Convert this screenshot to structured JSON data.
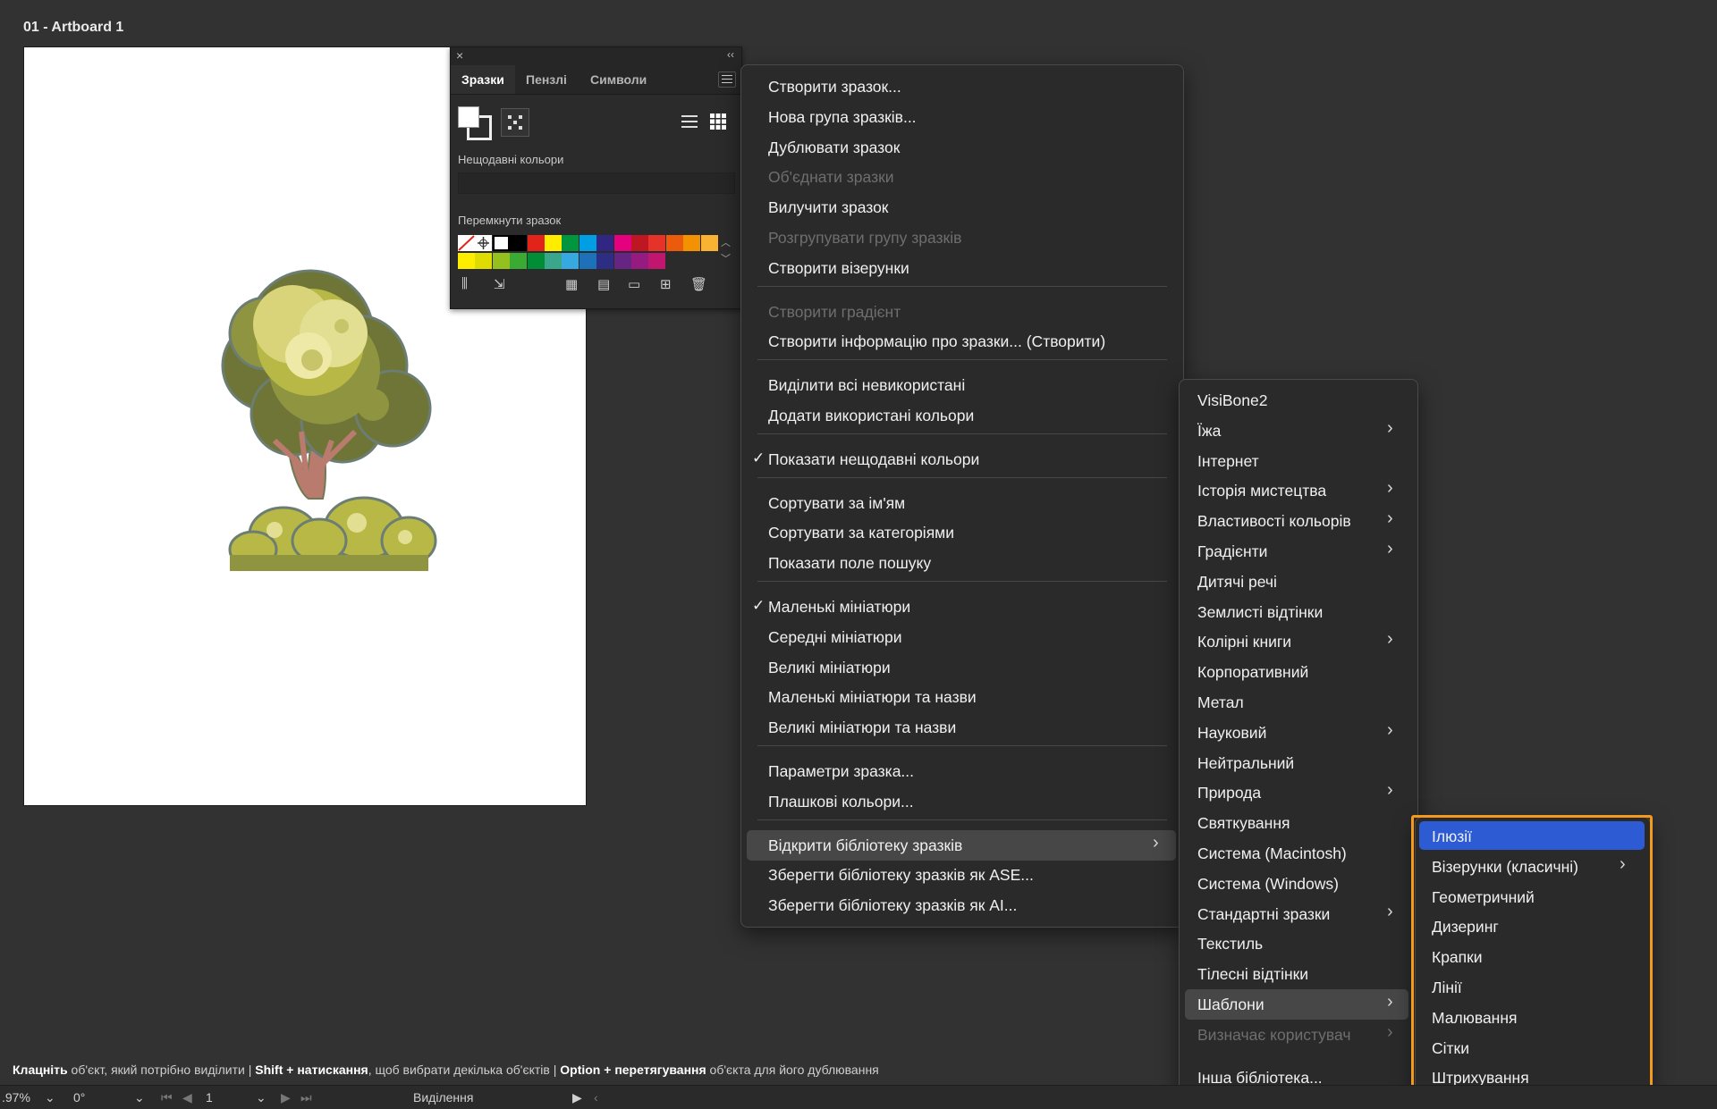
{
  "artboard": {
    "label": "01 - Artboard 1"
  },
  "panel": {
    "tabs": [
      "Зразки",
      "Пензлі",
      "Символи"
    ],
    "recent_colors_label": "Нещодавні кольори",
    "toggle_swatch_label": "Перемкнути зразок",
    "swatch_row1": [
      "#ffffff",
      "#ffffff",
      "#ffffff",
      "#000000",
      "#e2231a",
      "#ffed00",
      "#00963f",
      "#009ee3",
      "#312783",
      "#e5007d",
      "#be1622",
      "#e6332a",
      "#ea5b0c",
      "#f39200",
      "#f9b233"
    ],
    "swatch_row2": [
      "#ffed00",
      "#dedc00",
      "#95c11f",
      "#3aaa35",
      "#008d36",
      "#3aa78c",
      "#36a9e1",
      "#1d71b8",
      "#2d2e83",
      "#662483",
      "#951b81",
      "#c0166f"
    ]
  },
  "main_menu": {
    "items": [
      {
        "label": "Створити зразок...",
        "disabled": false
      },
      {
        "label": "Нова група зразків...",
        "disabled": false
      },
      {
        "label": "Дублювати зразок",
        "disabled": false
      },
      {
        "label": "Об'єднати зразки",
        "disabled": true
      },
      {
        "label": "Вилучити зразок",
        "disabled": false
      },
      {
        "label": "Розгрупувати групу зразків",
        "disabled": true
      },
      {
        "label": "Створити візерунки",
        "disabled": false
      },
      {
        "label": "Створити градієнт",
        "disabled": true
      },
      {
        "label": "Створити інформацію про зразки... (Створити)",
        "disabled": false
      },
      {
        "label": "Виділити всі невикористані",
        "disabled": false
      },
      {
        "label": "Додати використані кольори",
        "disabled": false
      },
      {
        "label": "Показати нещодавні кольори",
        "checked": true
      },
      {
        "label": "Сортувати за ім'ям",
        "disabled": false
      },
      {
        "label": "Сортувати за категоріями",
        "disabled": false
      },
      {
        "label": "Показати поле пошуку",
        "disabled": false
      },
      {
        "label": "Маленькі мініатюри",
        "checked": true
      },
      {
        "label": "Середні мініатюри",
        "disabled": false
      },
      {
        "label": "Великі мініатюри",
        "disabled": false
      },
      {
        "label": "Маленькі мініатюри та назви",
        "disabled": false
      },
      {
        "label": "Великі мініатюри та назви",
        "disabled": false
      },
      {
        "label": "Параметри зразка...",
        "disabled": false
      },
      {
        "label": "Плашкові кольори...",
        "disabled": false
      },
      {
        "label": "Відкрити бібліотеку зразків",
        "submenu": true,
        "highlighted": true
      },
      {
        "label": "Зберегти бібліотеку зразків як ASE...",
        "disabled": false
      },
      {
        "label": "Зберегти бібліотеку зразків як AI...",
        "disabled": false
      }
    ],
    "check_glyph": "✓",
    "arrow_glyph": "›"
  },
  "library_menu": {
    "items": [
      {
        "label": "VisiBone2"
      },
      {
        "label": "Їжа",
        "submenu": true
      },
      {
        "label": "Інтернет"
      },
      {
        "label": "Історія мистецтва",
        "submenu": true
      },
      {
        "label": "Властивості кольорів",
        "submenu": true
      },
      {
        "label": "Градієнти",
        "submenu": true
      },
      {
        "label": "Дитячі речі"
      },
      {
        "label": "Землисті відтінки"
      },
      {
        "label": "Колірні книги",
        "submenu": true
      },
      {
        "label": "Корпоративний"
      },
      {
        "label": "Метал"
      },
      {
        "label": "Науковий",
        "submenu": true
      },
      {
        "label": "Нейтральний"
      },
      {
        "label": "Природа",
        "submenu": true
      },
      {
        "label": "Святкування"
      },
      {
        "label": "Система (Macintosh)"
      },
      {
        "label": "Система (Windows)"
      },
      {
        "label": "Стандартні зразки",
        "submenu": true
      },
      {
        "label": "Текстиль"
      },
      {
        "label": "Тілесні відтінки"
      },
      {
        "label": "Шаблони",
        "submenu": true,
        "highlighted": true
      },
      {
        "label": "Визначає користувач",
        "submenu": true,
        "disabled": true
      },
      {
        "label": "Інша бібліотека..."
      }
    ]
  },
  "patterns_menu": {
    "items": [
      {
        "label": "Ілюзії",
        "selected": true
      },
      {
        "label": "Візерунки (класичні)",
        "submenu": true
      },
      {
        "label": "Геометричний"
      },
      {
        "label": "Дизеринг"
      },
      {
        "label": "Крапки"
      },
      {
        "label": "Лінії"
      },
      {
        "label": "Малювання"
      },
      {
        "label": "Сітки"
      },
      {
        "label": "Штрихування"
      }
    ]
  },
  "status": {
    "part1_bold": "Клацніть",
    "part1": " об'єкт, який потрібно виділити  |  ",
    "part2_bold": "Shift + натискання",
    "part2": ", щоб вибрати декілька об'єктів  |  ",
    "part3_bold": "Option + перетягування",
    "part3": " об'єкта для його дублювання"
  },
  "bottom_bar": {
    "zoom": ".97%",
    "rotation": "0°",
    "artboard_number": "1",
    "tool_label": "Виділення"
  },
  "colors": {
    "selection_blue": "#2c5bd4",
    "callout_orange": "#f39a1e"
  }
}
